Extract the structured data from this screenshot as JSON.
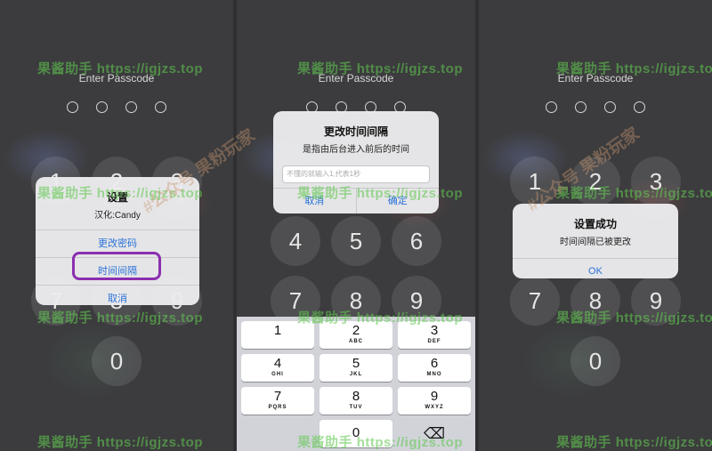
{
  "lock": {
    "enter_passcode": "Enter Passcode",
    "keys": [
      "1",
      "2",
      "3",
      "4",
      "5",
      "6",
      "7",
      "8",
      "9",
      "0"
    ]
  },
  "panel1": {
    "alert": {
      "title": "设置",
      "subtitle": "汉化:Candy",
      "buttons": [
        "更改密码",
        "时间间隔",
        "取消"
      ],
      "highlighted": "时间间隔"
    }
  },
  "panel2": {
    "alert": {
      "title": "更改时间间隔",
      "subtitle": "是指由后台进入前后的时间",
      "placeholder": "不懂的就输入1,代表1秒",
      "cancel": "取消",
      "confirm": "确定"
    },
    "keyboard": {
      "keys": [
        {
          "d": "1",
          "l": ""
        },
        {
          "d": "2",
          "l": "ABC"
        },
        {
          "d": "3",
          "l": "DEF"
        },
        {
          "d": "4",
          "l": "GHI"
        },
        {
          "d": "5",
          "l": "JKL"
        },
        {
          "d": "6",
          "l": "MNO"
        },
        {
          "d": "7",
          "l": "PQRS"
        },
        {
          "d": "8",
          "l": "TUV"
        },
        {
          "d": "9",
          "l": "WXYZ"
        },
        {
          "d": "0",
          "l": ""
        }
      ],
      "delete_icon": "⌫"
    }
  },
  "panel3": {
    "alert": {
      "title": "设置成功",
      "subtitle": "时间间隔已被更改",
      "ok": "OK"
    }
  },
  "watermark": {
    "brand": "果酱助手",
    "url": "https://igjzs.top",
    "secondary": "#公众号 果粉玩家"
  },
  "colors": {
    "accent": "#2b72d8",
    "highlight": "#8b2fb0",
    "watermark": "#60c850"
  }
}
